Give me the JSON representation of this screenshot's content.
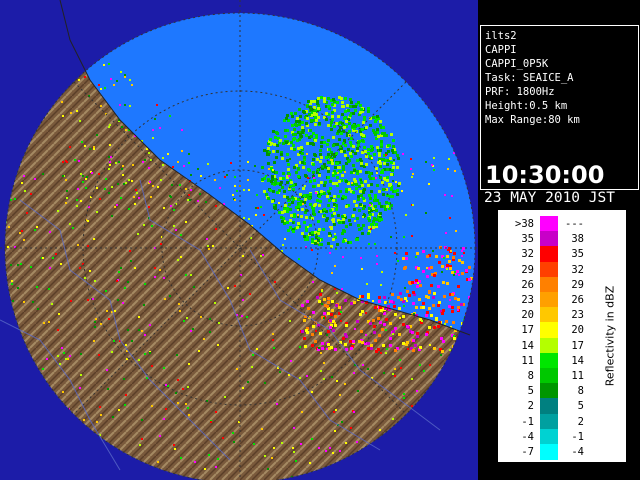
{
  "info": {
    "lines": [
      "ilts2",
      "CAPPI",
      "CAPPI_0P5K",
      "Task: SEAICE_A",
      "PRF: 1800Hz",
      "Height:0.5 km",
      "Max Range:80 km"
    ],
    "time": "10:30:00",
    "date": "23 MAY 2010 JST"
  },
  "legend": {
    "title": "Reflectivity in dBZ",
    "rows": [
      {
        "low": ">38",
        "high": "---",
        "color": "#ff00ff"
      },
      {
        "low": "35",
        "high": "38",
        "color": "#c800c8"
      },
      {
        "low": "32",
        "high": "35",
        "color": "#ff0000"
      },
      {
        "low": "29",
        "high": "32",
        "color": "#ff4000"
      },
      {
        "low": "26",
        "high": "29",
        "color": "#ff8000"
      },
      {
        "low": "23",
        "high": "26",
        "color": "#ffa000"
      },
      {
        "low": "20",
        "high": "23",
        "color": "#ffc800"
      },
      {
        "low": "17",
        "high": "20",
        "color": "#ffff00"
      },
      {
        "low": "14",
        "high": "17",
        "color": "#b4ff00"
      },
      {
        "low": "11",
        "high": "14",
        "color": "#00e600"
      },
      {
        "low": "8",
        "high": "11",
        "color": "#00c800"
      },
      {
        "low": "5",
        "high": "8",
        "color": "#009600"
      },
      {
        "low": "2",
        "high": "5",
        "color": "#008080"
      },
      {
        "low": "-1",
        "high": "2",
        "color": "#00a0a0"
      },
      {
        "low": "-4",
        "high": "-1",
        "color": "#00d2d2"
      },
      {
        "low": "-7",
        "high": "-4",
        "color": "#00ffff"
      }
    ]
  },
  "colors": {
    "sea": "#1e78ff",
    "land": "#7a5a3c",
    "outside": "#1c1ca8"
  }
}
